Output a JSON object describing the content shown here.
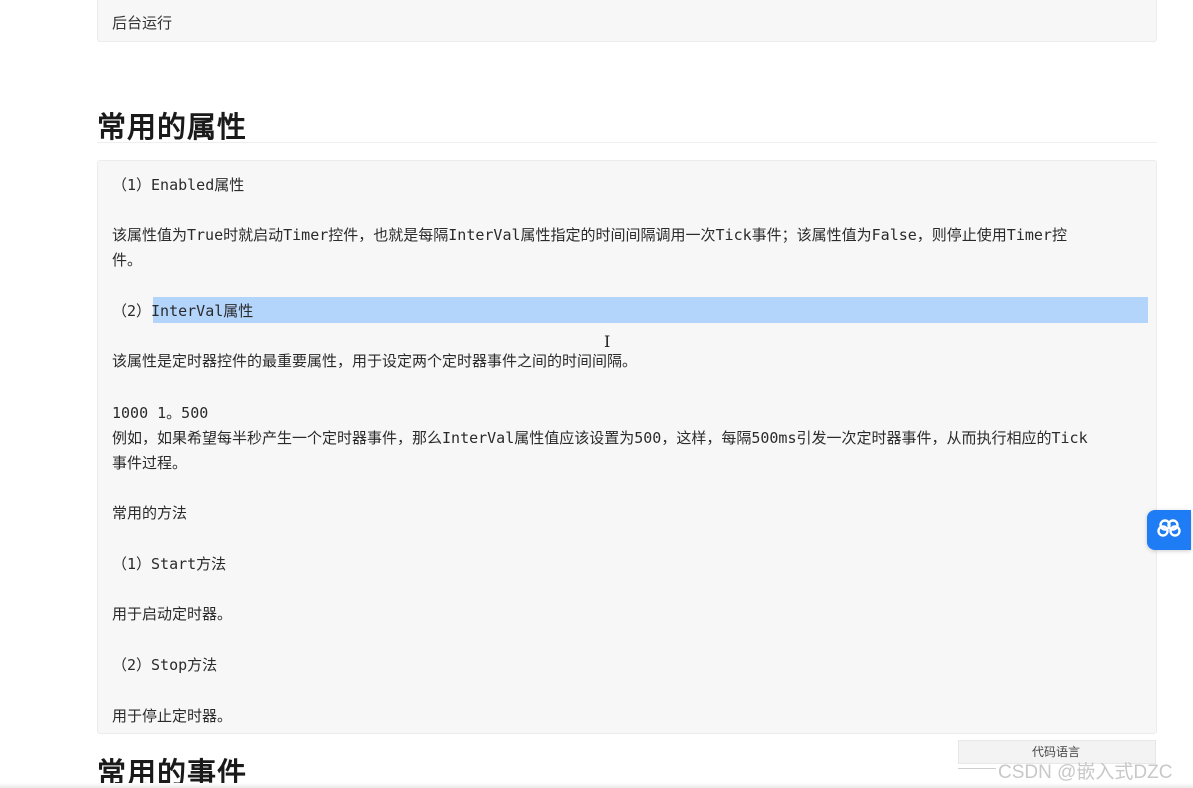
{
  "top_block": {
    "text": "后台运行"
  },
  "section1": {
    "title": "常用的属性"
  },
  "main_block": {
    "line1": "（1）Enabled属性",
    "line2a": "该属性值为True时就启动Timer控件，也就是每隔InterVal属性指定的时间间隔调用一次Tick事件；该属性值为False，则停止使用Timer控",
    "line2b": "件。",
    "line3": "（2）",
    "line3_selected": "InterVal属性",
    "line4": "该属性是定时器控件的最重要属性，用于设定两个定时器事件之间的时间间隔。",
    "line5": "1000 1。500",
    "line6a": "例如，如果希望每半秒产生一个定时器事件，那么InterVal属性值应该设置为500，这样，每隔500ms引发一次定时器事件，从而执行相应的Tick",
    "line6b": "事件过程。",
    "line7": " 常用的方法",
    "line8": "（1）Start方法",
    "line9": "用于启动定时器。",
    "line10": "（2）Stop方法",
    "line11": "用于停止定时器。"
  },
  "section2": {
    "title": "常用的事件"
  },
  "code_language": {
    "label": "代码语言"
  },
  "watermark": {
    "text": "CSDN @嵌入式DZC"
  },
  "float_button": {
    "icon": "cloud-link-icon",
    "color": "#1e7cf5"
  },
  "colors": {
    "selection": "#b3d4fb",
    "block_bg": "#f7f7f7"
  }
}
